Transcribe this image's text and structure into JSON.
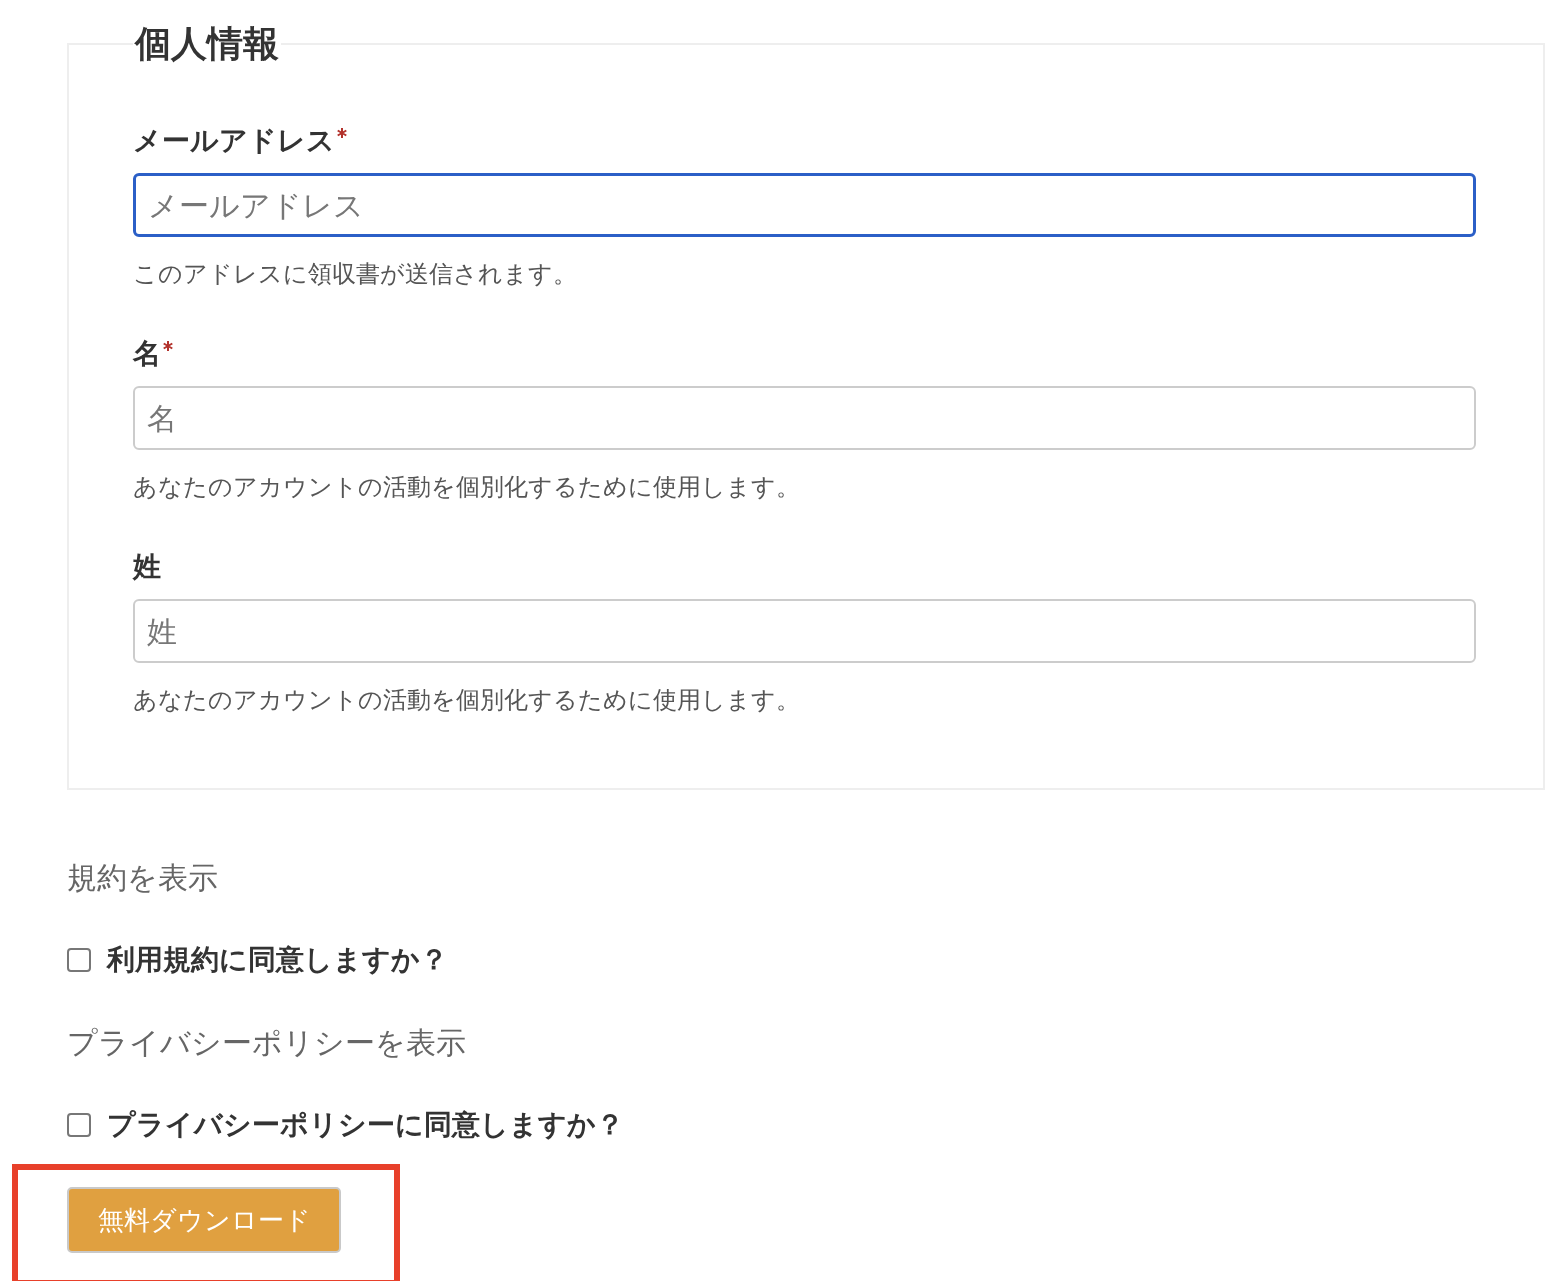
{
  "section": {
    "legend": "個人情報",
    "fields": [
      {
        "label": "メールアドレス",
        "required": true,
        "placeholder": "メールアドレス",
        "focused": true,
        "help": "このアドレスに領収書が送信されます。"
      },
      {
        "label": "名",
        "required": true,
        "placeholder": "名",
        "focused": false,
        "help": "あなたのアカウントの活動を個別化するために使用します。"
      },
      {
        "label": "姓",
        "required": false,
        "placeholder": "姓",
        "focused": false,
        "help": "あなたのアカウントの活動を個別化するために使用します。"
      }
    ]
  },
  "agreements": [
    {
      "link": "規約を表示",
      "label": "利用規約に同意しますか？",
      "checked": false
    },
    {
      "link": "プライバシーポリシーを表示",
      "label": "プライバシーポリシーに同意しますか？",
      "checked": false
    }
  ],
  "submit": {
    "label": "無料ダウンロード",
    "highlighted": true
  }
}
